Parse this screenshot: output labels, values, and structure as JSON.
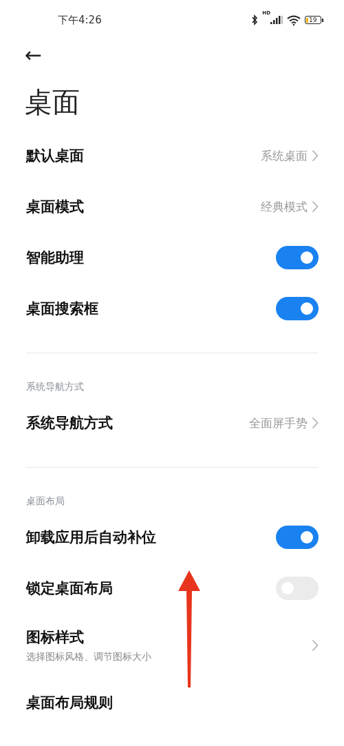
{
  "status_bar": {
    "time": "下午4:26",
    "network_label": "HD",
    "battery": "19"
  },
  "header": {
    "back": "←",
    "title": "桌面"
  },
  "sections": [
    {
      "items": [
        {
          "kind": "link",
          "label": "默认桌面",
          "value": "系统桌面"
        },
        {
          "kind": "link",
          "label": "桌面模式",
          "value": "经典模式"
        },
        {
          "kind": "toggle",
          "label": "智能助理",
          "on": true
        },
        {
          "kind": "toggle",
          "label": "桌面搜索框",
          "on": true
        }
      ]
    },
    {
      "heading": "系统导航方式",
      "items": [
        {
          "kind": "link",
          "label": "系统导航方式",
          "value": "全面屏手势"
        }
      ]
    },
    {
      "heading": "桌面布局",
      "items": [
        {
          "kind": "toggle",
          "label": "卸载应用后自动补位",
          "on": true
        },
        {
          "kind": "toggle",
          "label": "锁定桌面布局",
          "on": false
        },
        {
          "kind": "link",
          "label": "图标样式",
          "subtitle": "选择图标风格、调节图标大小"
        },
        {
          "kind": "plain",
          "label": "桌面布局规则"
        }
      ]
    }
  ],
  "annotation": {
    "kind": "arrow"
  }
}
